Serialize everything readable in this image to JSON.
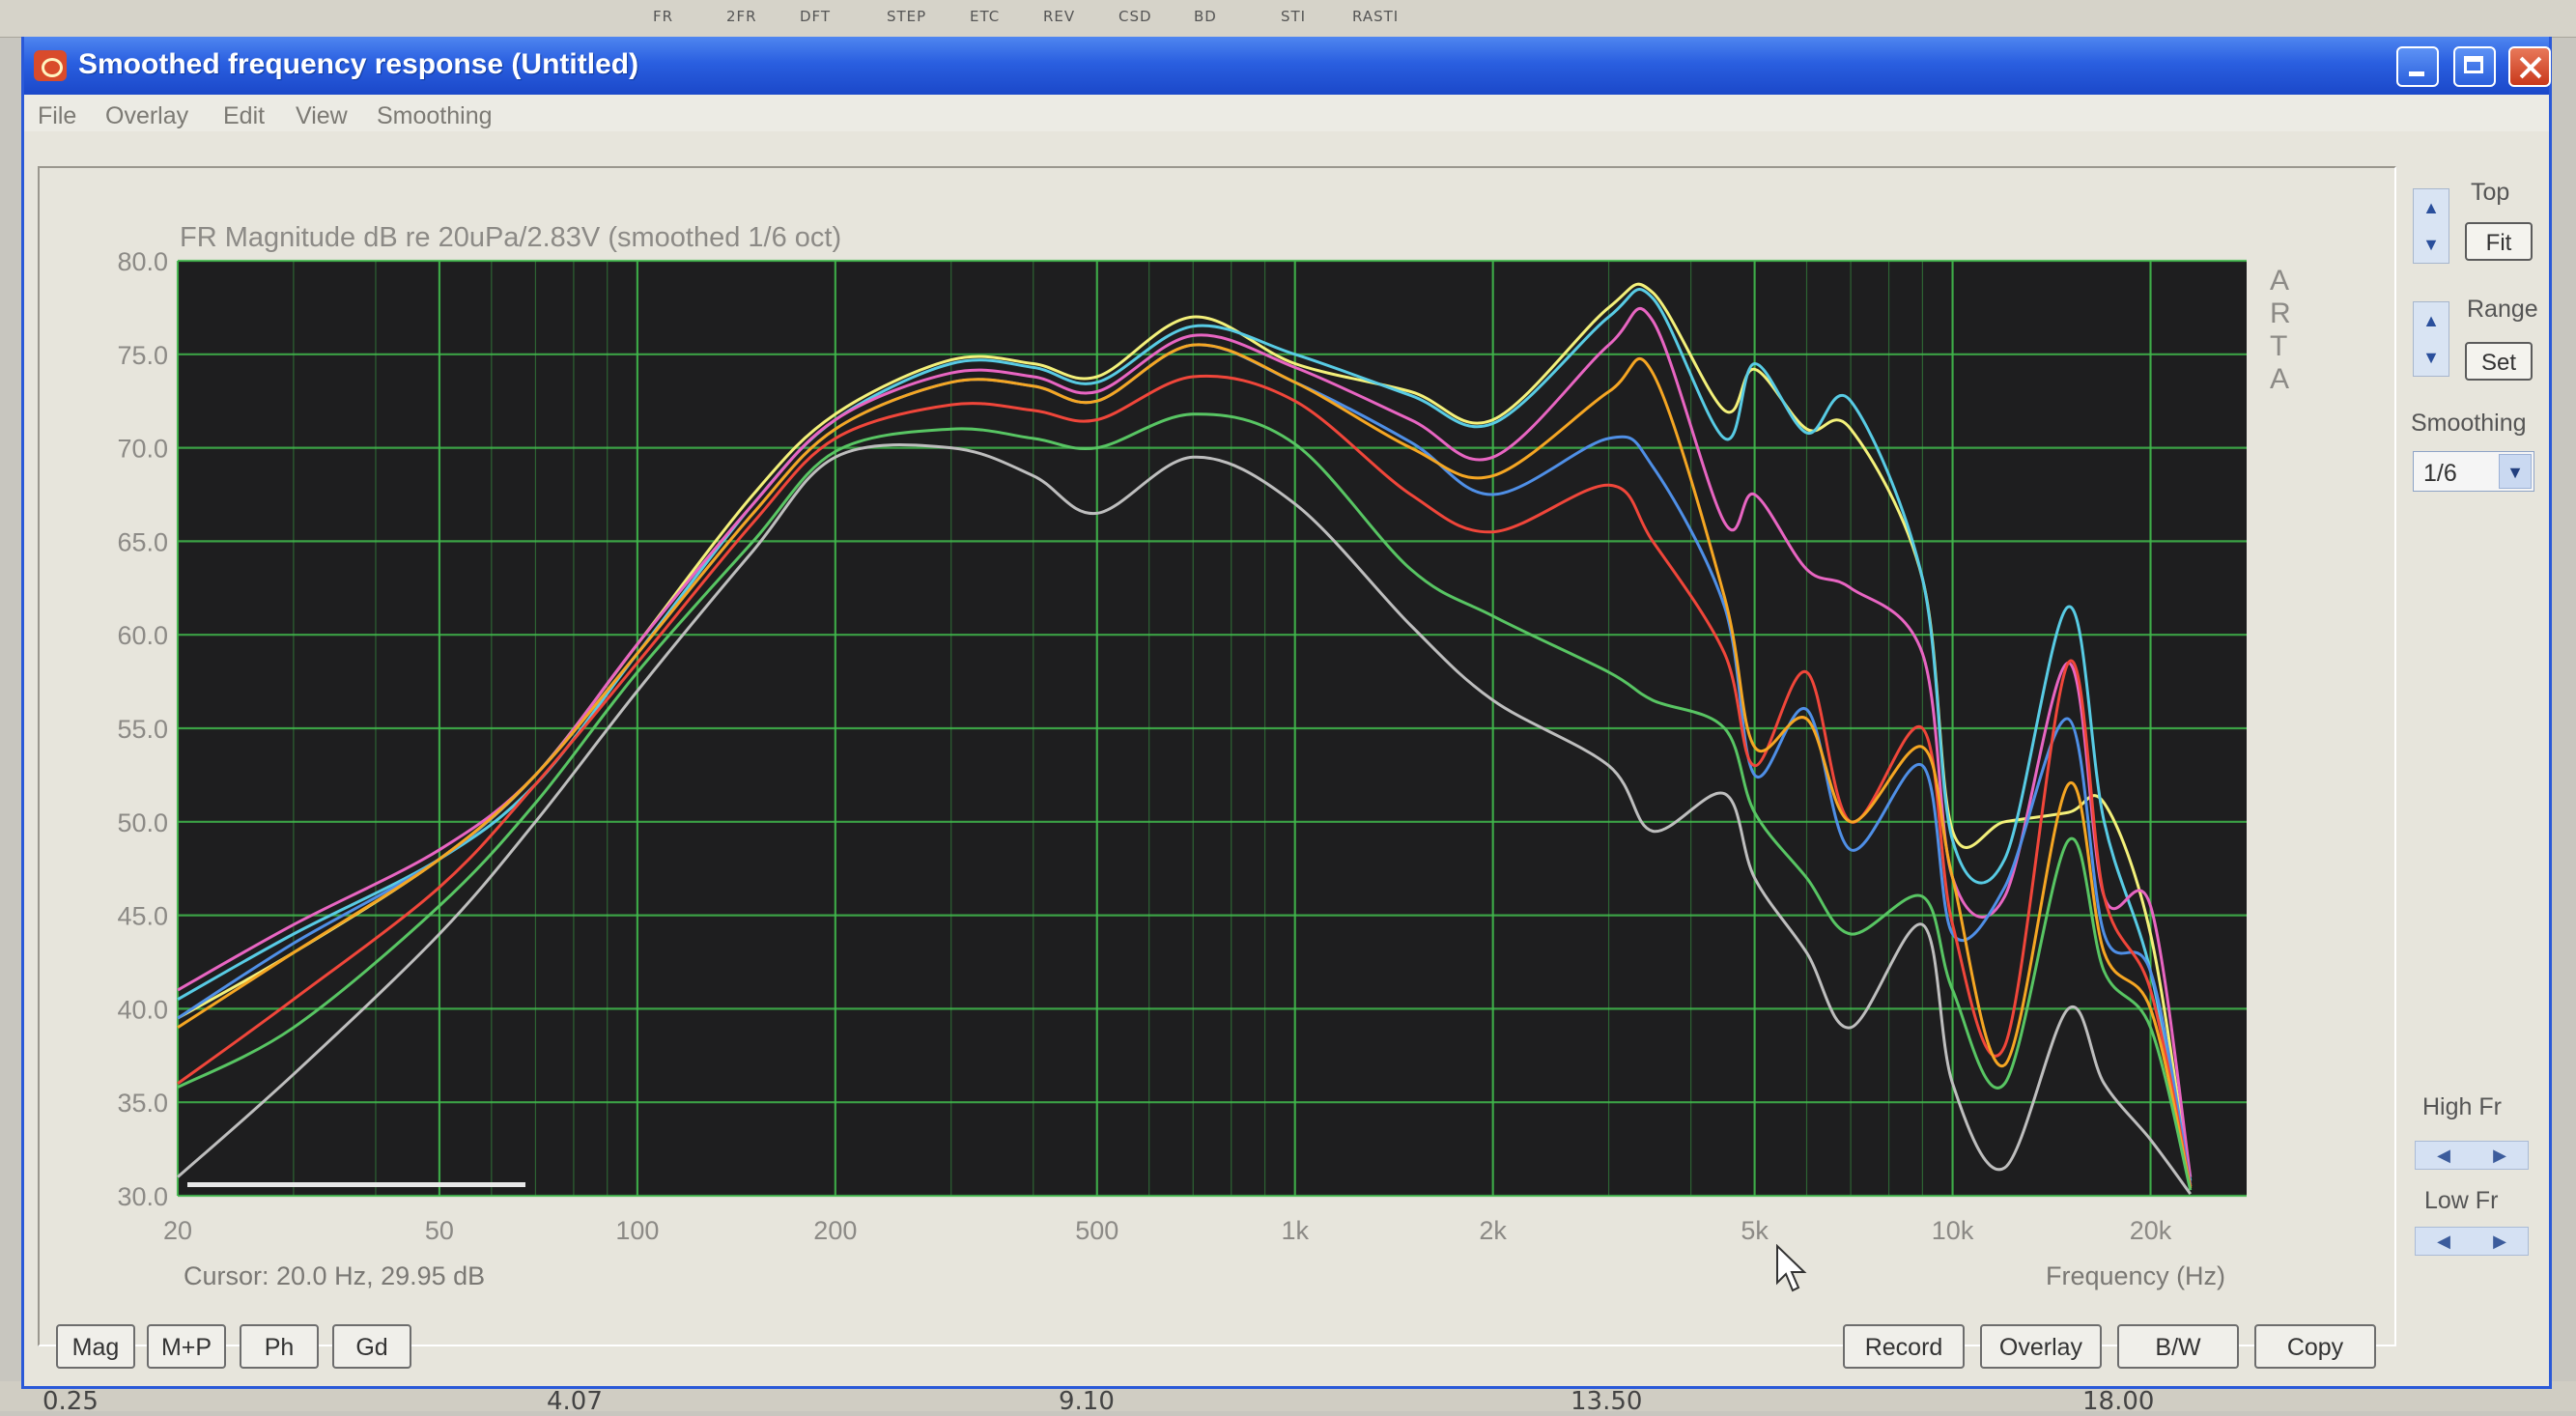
{
  "background_toolbar": {
    "items": [
      "FR",
      "2FR",
      "DFT",
      "STEP",
      "ETC",
      "REV",
      "CSD",
      "BD",
      "STI",
      "RASTI"
    ]
  },
  "background_axis_ticks": [
    "0.25",
    "4.07",
    "9.10",
    "13.50",
    "18.00"
  ],
  "window": {
    "title": "Smoothed frequency response (Untitled)"
  },
  "menu": {
    "items": [
      "File",
      "Overlay",
      "Edit",
      "View",
      "Smoothing"
    ]
  },
  "plot": {
    "watermark": "ARTA",
    "cursor_readout": "Cursor: 20.0 Hz, 29.95 dB",
    "xaxis_label": "Frequency (Hz)"
  },
  "chart_data": {
    "type": "line",
    "title": "FR Magnitude dB re 20uPa/2.83V (smoothed 1/6 oct)",
    "xlabel": "Frequency (Hz)",
    "ylabel": "",
    "xscale": "log",
    "xlim": [
      20,
      28000
    ],
    "ylim": [
      30,
      80
    ],
    "xticks": [
      20,
      50,
      100,
      200,
      500,
      1000,
      2000,
      5000,
      10000,
      20000
    ],
    "xtick_labels": [
      "20",
      "50",
      "100",
      "200",
      "500",
      "1k",
      "2k",
      "5k",
      "10k",
      "20k"
    ],
    "yticks": [
      30,
      35,
      40,
      45,
      50,
      55,
      60,
      65,
      70,
      75,
      80
    ],
    "ytick_labels": [
      "30.0",
      "35.0",
      "40.0",
      "45.0",
      "50.0",
      "55.0",
      "60.0",
      "65.0",
      "70.0",
      "75.0",
      "80.0"
    ],
    "grid": true,
    "background": "#1e1e1f",
    "grid_color": "#41b84c",
    "series": [
      {
        "color": "#f3f07a",
        "x": [
          20,
          30,
          50,
          70,
          100,
          150,
          200,
          300,
          400,
          500,
          700,
          1000,
          1500,
          2000,
          3000,
          3500,
          4500,
          5000,
          6000,
          7000,
          9000,
          10000,
          12000,
          15000,
          17000,
          20000,
          23000
        ],
        "y": [
          39.5,
          43,
          48,
          52.5,
          59.5,
          67.5,
          71.8,
          74.7,
          74.5,
          73.8,
          77,
          74.5,
          73,
          71.5,
          77.5,
          78.3,
          72,
          74.2,
          71,
          71,
          63,
          49.5,
          50,
          50.5,
          51,
          44,
          30.5
        ]
      },
      {
        "color": "#58cbe4",
        "x": [
          20,
          30,
          50,
          70,
          100,
          150,
          200,
          300,
          400,
          500,
          700,
          1000,
          1500,
          2000,
          3000,
          3500,
          4500,
          5000,
          6000,
          7000,
          9000,
          10000,
          12000,
          15000,
          17000,
          20000,
          23000
        ],
        "y": [
          40.5,
          44,
          48,
          52,
          59,
          67,
          71.5,
          74.5,
          74.3,
          73.5,
          76.5,
          75,
          72.8,
          71.3,
          77,
          78,
          70.5,
          74.5,
          70.8,
          72.5,
          63,
          49,
          48,
          61.5,
          50,
          42,
          30.8
        ]
      },
      {
        "color": "#e865c2",
        "x": [
          20,
          30,
          50,
          70,
          100,
          150,
          200,
          300,
          400,
          500,
          700,
          1000,
          1500,
          2000,
          3000,
          3500,
          4500,
          5000,
          6000,
          7000,
          9000,
          10000,
          12000,
          15000,
          17000,
          20000,
          23000
        ],
        "y": [
          41,
          44.5,
          48.5,
          52.5,
          59.5,
          67,
          71.5,
          74,
          73.8,
          73,
          76,
          74.3,
          71.5,
          69.5,
          75.5,
          76.8,
          66,
          67.5,
          63.5,
          62.5,
          59,
          47,
          46,
          58.5,
          46,
          45.5,
          31
        ]
      },
      {
        "color": "#4f8fe6",
        "x": [
          20,
          30,
          50,
          70,
          100,
          150,
          200,
          300,
          400,
          500,
          700,
          1000,
          1500,
          2000,
          3000,
          3500,
          4500,
          5000,
          6000,
          7000,
          9000,
          10000,
          12000,
          15000,
          17000,
          20000,
          23000
        ],
        "y": [
          39.5,
          43.5,
          48,
          52.5,
          59,
          66.5,
          71,
          73.5,
          73.3,
          72.5,
          75.5,
          73.5,
          70.3,
          67.5,
          70.5,
          69,
          61.5,
          52.5,
          56,
          48.5,
          53,
          44,
          46.5,
          55.5,
          44,
          42,
          30.6
        ]
      },
      {
        "color": "#f0463a",
        "x": [
          20,
          30,
          50,
          70,
          100,
          150,
          200,
          300,
          400,
          500,
          700,
          1000,
          1500,
          2000,
          3000,
          3500,
          4500,
          5000,
          6000,
          7000,
          9000,
          10000,
          12000,
          15000,
          17000,
          20000,
          23000
        ],
        "y": [
          36,
          40.5,
          46.5,
          52,
          58.5,
          66,
          70.5,
          72.3,
          72,
          71.5,
          73.8,
          72.5,
          67.5,
          65.5,
          68,
          65,
          59,
          53,
          58,
          50,
          55,
          44.5,
          38,
          58.5,
          46,
          41,
          30.5
        ]
      },
      {
        "color": "#f5a623",
        "x": [
          20,
          30,
          50,
          70,
          100,
          150,
          200,
          300,
          400,
          500,
          700,
          1000,
          1500,
          2000,
          3000,
          3500,
          4500,
          5000,
          6000,
          7000,
          9000,
          10000,
          12000,
          15000,
          17000,
          20000,
          23000
        ],
        "y": [
          39,
          43,
          48,
          52.5,
          59,
          66.5,
          71,
          73.5,
          73.3,
          72.5,
          75.5,
          73.5,
          70,
          68.5,
          73,
          74,
          62,
          54,
          55.5,
          50,
          54,
          47,
          37,
          52,
          43,
          40,
          30.4
        ]
      },
      {
        "color": "#58c563",
        "x": [
          20,
          30,
          50,
          70,
          100,
          150,
          200,
          300,
          400,
          500,
          700,
          1000,
          1500,
          2000,
          3000,
          3500,
          4500,
          5000,
          6000,
          7000,
          9000,
          10000,
          12000,
          15000,
          17000,
          20000,
          23000
        ],
        "y": [
          35.8,
          39,
          45.5,
          51,
          58,
          65,
          69.8,
          71,
          70.5,
          70,
          71.8,
          70.2,
          63.5,
          61,
          58,
          56.5,
          55,
          50.5,
          47,
          44,
          46,
          41,
          36,
          49,
          42,
          39,
          30.3
        ]
      },
      {
        "color": "#bebebe",
        "x": [
          20,
          30,
          50,
          70,
          100,
          150,
          200,
          300,
          400,
          500,
          700,
          1000,
          1500,
          2000,
          3000,
          3500,
          4500,
          5000,
          6000,
          7000,
          9000,
          10000,
          12000,
          15000,
          17000,
          20000,
          23000
        ],
        "y": [
          31,
          36.5,
          44,
          50,
          57,
          64.5,
          69.5,
          70,
          68.5,
          66.5,
          69.5,
          67,
          60.5,
          56.5,
          53,
          49.5,
          51.5,
          47,
          43,
          39,
          44.5,
          36,
          31.5,
          40,
          36,
          33,
          30.1
        ]
      }
    ]
  },
  "right_panel": {
    "top_label": "Top",
    "fit_label": "Fit",
    "range_label": "Range",
    "set_label": "Set",
    "smoothing_label": "Smoothing",
    "smoothing_value": "1/6",
    "high_fr_label": "High Fr",
    "low_fr_label": "Low Fr"
  },
  "bottom_buttons": {
    "left": [
      "Mag",
      "M+P",
      "Ph",
      "Gd"
    ],
    "right": [
      "Record",
      "Overlay",
      "B/W",
      "Copy"
    ]
  }
}
